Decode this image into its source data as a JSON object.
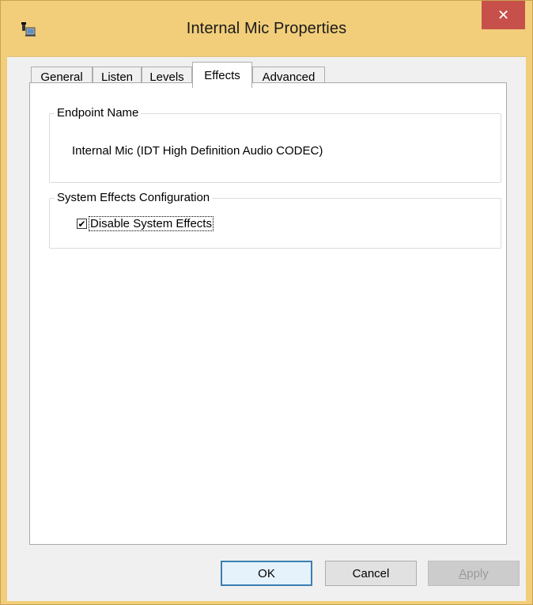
{
  "window": {
    "title": "Internal Mic Properties",
    "close_glyph": "✕",
    "accent_color": "#f2ce7a",
    "close_color": "#c7504a",
    "icon": "microphone-icon"
  },
  "tabs": [
    {
      "label": "General",
      "active": false
    },
    {
      "label": "Listen",
      "active": false
    },
    {
      "label": "Levels",
      "active": false
    },
    {
      "label": "Effects",
      "active": true
    },
    {
      "label": "Advanced",
      "active": false
    }
  ],
  "endpoint": {
    "legend": "Endpoint Name",
    "value": "Internal Mic (IDT High Definition Audio CODEC)"
  },
  "system_effects": {
    "legend": "System Effects Configuration",
    "checkbox_label": "Disable System Effects",
    "checked": true,
    "check_glyph": "✔"
  },
  "buttons": {
    "ok": "OK",
    "cancel": "Cancel",
    "apply_first": "A",
    "apply_rest": "pply"
  }
}
